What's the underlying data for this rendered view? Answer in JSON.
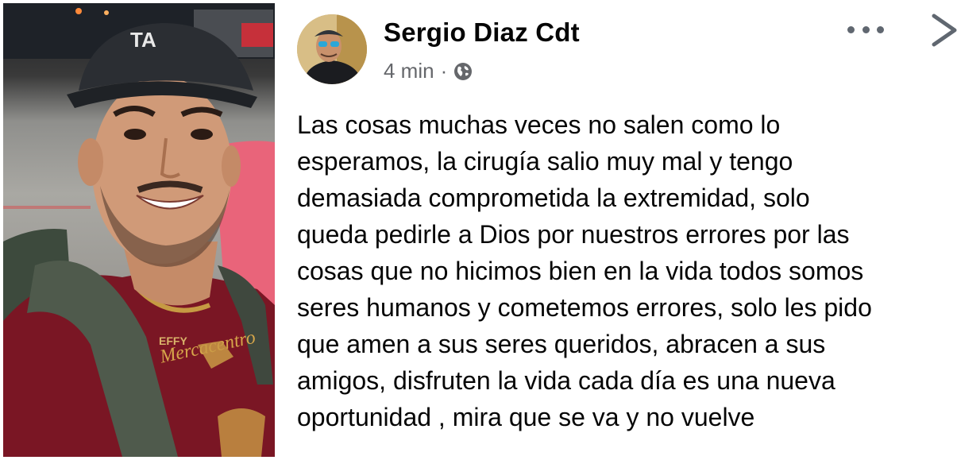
{
  "post": {
    "author_name": "Sergio Diaz Cdt",
    "timestamp": "4 min",
    "separator": "·",
    "privacy_icon": "globe-icon",
    "more_icon": "more-horizontal-icon",
    "close_icon": "close-icon",
    "text_lines": [
      "Las cosas muchas veces no salen como lo",
      "esperamos, la cirugía salio muy mal y tengo",
      "demasiada comprometida la extremidad, solo",
      "queda pedirle a Dios por nuestros errores por las",
      "cosas que no hicimos bien en la vida todos somos",
      "seres humanos y cometemos errores, solo les pido",
      "que amen a  sus seres queridos, abracen a sus",
      "amigos, disfruten la vida cada día es una nueva",
      "oportunidad , mira que se va y no vuelve"
    ]
  },
  "photo": {
    "cap_text": "TA",
    "jersey_sponsor": "Mercacentro",
    "jersey_brand": "EFFY"
  },
  "colors": {
    "jersey": "#7a1624",
    "cap": "#2b2e33",
    "text": "#050505",
    "meta": "#65676b"
  }
}
